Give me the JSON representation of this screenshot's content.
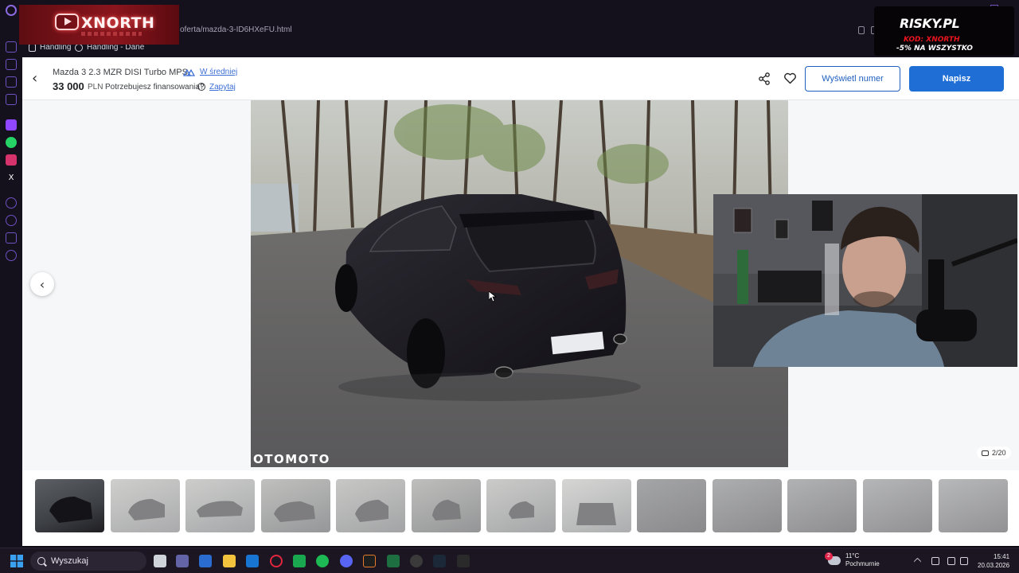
{
  "browser": {
    "url": "oferta/mazda-3-ID6HXeFU.html",
    "bookmarks": [
      {
        "label": "Handling"
      },
      {
        "label": "Handling - Dane"
      }
    ]
  },
  "overlays": {
    "xnorth_label": "XNORTH",
    "risky_logo": "RISKY.PL",
    "risky_code": "KOD: XNORTH",
    "risky_promo": "-5% NA WSZYSTKO"
  },
  "listing": {
    "title": "Mazda 3 2.3 MZR DISI Turbo MPS",
    "price_badge": "W średniej",
    "price": "33 000",
    "currency": "PLN",
    "financing_question": "Potrzebujesz finansowania?",
    "ask_link": "Zapytaj",
    "show_number_button": "Wyświetl numer",
    "write_button": "Napisz"
  },
  "gallery": {
    "watermark": "OTOMOTO",
    "counter": "2/20",
    "thumbnail_count": 13
  },
  "taskbar": {
    "search_placeholder": "Wyszukaj",
    "weather_temp": "11°C",
    "weather_desc": "Pochmurnie",
    "weather_badge": "2",
    "time": "15:41",
    "date": "20.03.2026"
  },
  "colors": {
    "brand_blue": "#1f6ed6",
    "link_blue": "#3d6fd6",
    "overlay_red": "#8a151d"
  }
}
